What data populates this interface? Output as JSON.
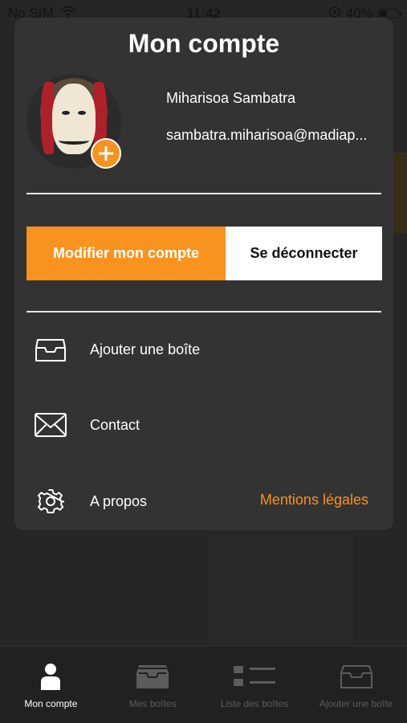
{
  "status_bar": {
    "carrier": "No SIM",
    "time": "11:42",
    "battery_percent": "40%",
    "battery_level": 0.4
  },
  "account": {
    "title": "Mon compte",
    "user_name": "Miharisoa Sambatra",
    "user_email": "sambatra.miharisoa@madiap...",
    "edit_button": "Modifier mon compte",
    "logout_button": "Se déconnecter"
  },
  "menu": {
    "items": [
      {
        "label": "Ajouter une boîte",
        "icon": "inbox-tray-icon"
      },
      {
        "label": "Contact",
        "icon": "envelope-icon"
      },
      {
        "label": "A propos",
        "icon": "gear-icon"
      }
    ],
    "legal_link": "Mentions légales"
  },
  "tab_bar": {
    "tabs": [
      {
        "label": "Mon compte",
        "icon": "person-icon",
        "active": true
      },
      {
        "label": "Mes boîtes",
        "icon": "inbox-tray-icon",
        "active": false
      },
      {
        "label": "Liste des boîtes",
        "icon": "list-icon",
        "active": false
      },
      {
        "label": "Ajouter une boîte",
        "icon": "inbox-tray-icon",
        "active": false
      }
    ]
  },
  "colors": {
    "accent": "#f7931e",
    "background": "#262626",
    "card": "#333333",
    "tab_inactive": "#5c5c5c"
  }
}
